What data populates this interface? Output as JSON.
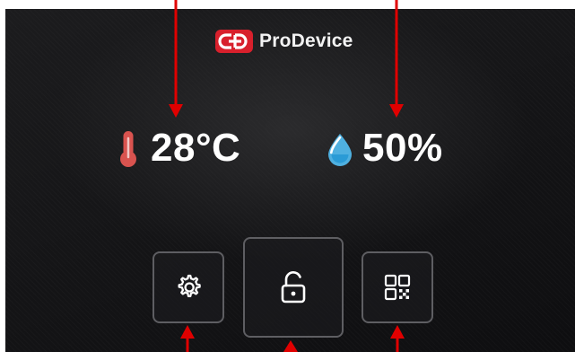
{
  "brand": {
    "name": "ProDevice",
    "logo_icon": "prodevice-logo"
  },
  "readings": {
    "temperature": {
      "value": "28°C",
      "icon": "thermometer-icon",
      "icon_color": "#d9534f"
    },
    "humidity": {
      "value": "50%",
      "icon": "water-drop-icon",
      "icon_color": "#4fb0e0"
    }
  },
  "buttons": [
    {
      "id": "settings",
      "icon": "gear-icon"
    },
    {
      "id": "unlock",
      "icon": "unlock-icon"
    },
    {
      "id": "qr",
      "icon": "qr-code-icon"
    }
  ],
  "colors": {
    "background": "#141416",
    "text": "#ffffff",
    "button_border": "#5e5e62",
    "brand_red": "#d8202c",
    "annotation_arrow": "#e00000"
  }
}
